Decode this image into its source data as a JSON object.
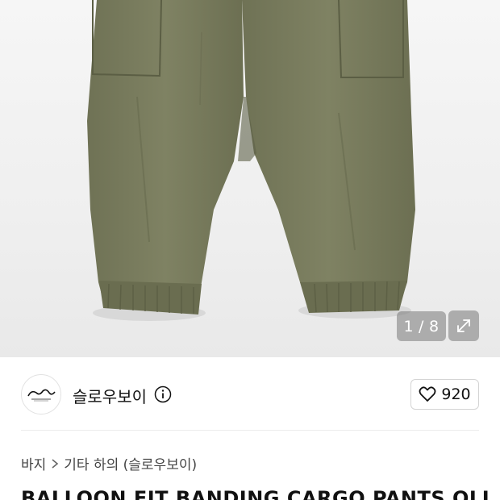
{
  "gallery": {
    "current_page": "1",
    "separator": "/",
    "total_pages": "8",
    "expand_icon": "expand-arrows-icon",
    "product_color": "#7a7c5e"
  },
  "brand": {
    "name": "슬로우보이",
    "logo_icon": "brand-logo",
    "info_icon": "info-icon"
  },
  "like": {
    "icon": "heart-outline-icon",
    "count": "920"
  },
  "breadcrumb": {
    "items": [
      "바지",
      "기타 하의 (슬로우보이)"
    ],
    "separator_icon": "chevron-right-icon"
  },
  "product": {
    "title": "BALLOON FIT BANDING CARGO PANTS OLI"
  }
}
